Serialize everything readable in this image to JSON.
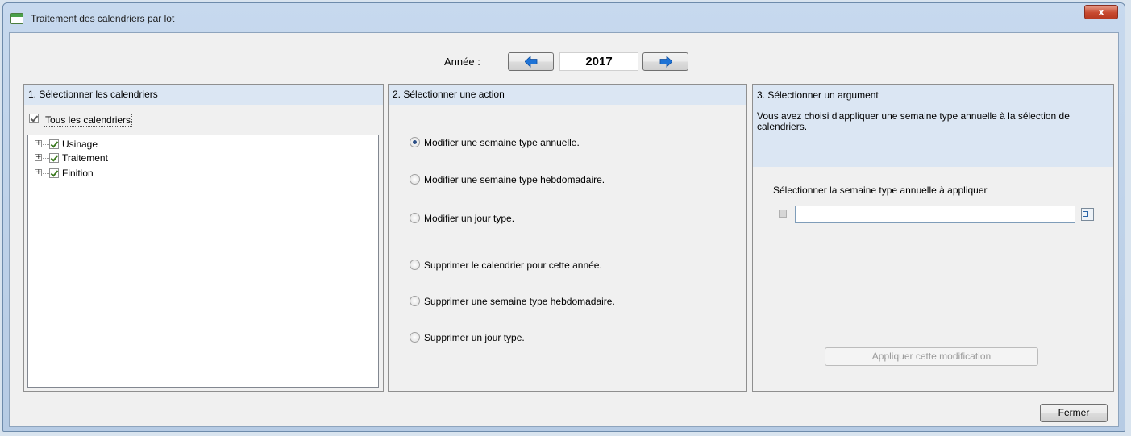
{
  "window": {
    "title": "Traitement des calendriers par lot",
    "close_label": "x"
  },
  "year_selector": {
    "label": "Année :",
    "value": "2017",
    "prev_icon": "arrow-left-icon",
    "next_icon": "arrow-right-icon"
  },
  "panel_calendars": {
    "header": "1. Sélectionner les calendriers",
    "all_label": "Tous les calendriers",
    "all_checked": true,
    "items": [
      {
        "label": "Usinage",
        "checked": true
      },
      {
        "label": "Traitement",
        "checked": true
      },
      {
        "label": "Finition",
        "checked": true
      }
    ]
  },
  "panel_actions": {
    "header": "2. Sélectionner une action",
    "options": [
      {
        "label": "Modifier une semaine type annuelle.",
        "selected": true
      },
      {
        "label": "Modifier une semaine type hebdomadaire.",
        "selected": false
      },
      {
        "label": "Modifier un jour type.",
        "selected": false
      },
      {
        "label": "Supprimer le calendrier pour cette année.",
        "selected": false
      },
      {
        "label": "Supprimer une semaine type hebdomadaire.",
        "selected": false
      },
      {
        "label": "Supprimer un jour type.",
        "selected": false
      }
    ]
  },
  "panel_argument": {
    "header": "3. Sélectionner un argument",
    "info": "Vous avez choisi d'appliquer une semaine type annuelle à la sélection de calendriers.",
    "select_label": "Sélectionner la semaine type annuelle à appliquer",
    "input_value": "",
    "apply_label": "Appliquer cette modification"
  },
  "footer": {
    "close_label": "Fermer"
  },
  "colors": {
    "header_bg": "#dbe6f3",
    "arrow": "#1e73d6",
    "close": "#c8492f"
  }
}
